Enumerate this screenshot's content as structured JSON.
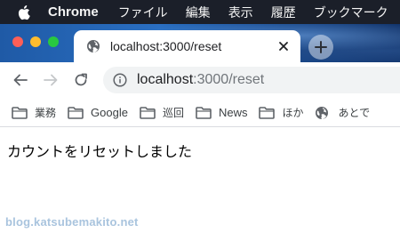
{
  "menubar": {
    "app_name": "Chrome",
    "items": [
      "ファイル",
      "編集",
      "表示",
      "履歴",
      "ブックマーク"
    ]
  },
  "tab": {
    "title": "localhost:3000/reset"
  },
  "address_bar": {
    "host": "localhost",
    "path": ":3000/reset"
  },
  "bookmarks": [
    {
      "label": "業務",
      "icon": "folder-icon"
    },
    {
      "label": "Google",
      "icon": "folder-icon"
    },
    {
      "label": "巡回",
      "icon": "folder-icon"
    },
    {
      "label": "News",
      "icon": "folder-icon"
    },
    {
      "label": "ほか",
      "icon": "folder-icon"
    },
    {
      "label": "あとで",
      "icon": "globe-icon"
    }
  ],
  "page": {
    "message": "カウントをリセットしました"
  },
  "watermark": "blog.katsubemakito.net",
  "colors": {
    "menubar_bg": "#1b1f29",
    "omnibox_bg": "#f1f3f4",
    "traffic_red": "#ff5f57",
    "traffic_yellow": "#febc2e",
    "traffic_green": "#28c840"
  }
}
